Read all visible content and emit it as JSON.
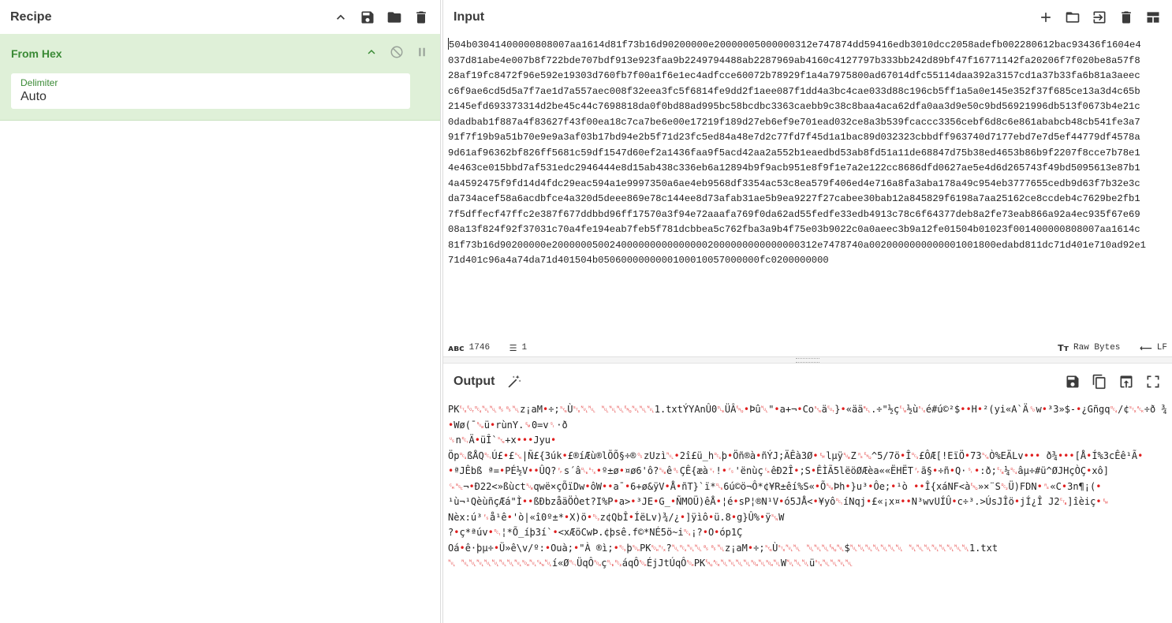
{
  "recipe": {
    "title": "Recipe",
    "operation": {
      "name": "From Hex",
      "delimiter_label": "Delimiter",
      "delimiter_value": "Auto"
    }
  },
  "input": {
    "title": "Input",
    "lines": [
      "504b03041400000808007aa1614d81f73b16d90200000e20000005000000312e747874dd59416edb3010dcc2058adefb002280612bac93436f1604e4",
      "037d81abe4e007b8f722bde707bdf913e923faa9b2249794488ab2287969ab4160c4127797b333bb242d89bf47f16771142fa20206f7f020be8a57f8",
      "28af19fc8472f96e592e19303d760fb7f00a1f6e1ec4adfcce60072b78929f1a4a7975800ad67014dfc55114daa392a3157cd1a37b33fa6b81a3aeec",
      "c6f9ae6cd5d5a7f7ae1d7a557aec008f32eea3fc5f6814fe9dd2f1aee087f1dd4a3bc4cae033d88c196cb5ff1a5a0e145e352f37f685ce13a3d4c65b",
      "2145efd693373314d2be45c44c7698818da0f0bd88ad995bc58bcdbc3363caebb9c38c8baa4aca62dfa0aa3d9e50c9bd56921996db513f0673b4e21c",
      "0dadbab1f887a4f83627f43f00ea18c7ca7be6e00e17219f189d27eb6ef9e701ead032ce8a3b539fcaccc3356cebf6d8c6e861ababcb48cb541fe3a7",
      "91f7f19b9a51b70e9e9a3af03b17bd94e2b5f71d23fc5ed84a48e7d2c77fd7f45d1a1bac89d032323cbbdff963740d7177ebd7e7d5ef44779df4578a",
      "9d61af96362bf826ff5681c59df1547d60ef2a1436faa9f5acd42aa2a552b1eaedbd53ab8fd51a11de68847d75b38ed4653b86b9f2207f8cce7b78e1",
      "4e463ce015bbd7af531edc2946444e8d15ab438c336eb6a12894b9f9acb951e8f9f1e7a2e122cc8686dfd0627ae5e4d6d265743f49bd5095613e87b1",
      "4a4592475f9fd14d4fdc29eac594a1e9997350a6ae4eb9568df3354ac53c8ea579f406ed4e716a8fa3aba178a49c954eb3777655cedb9d63f7b32e3c",
      "da734acef58a6acdbfce4a320d5deee869e78c144ee8d73afab31ae5b9ea9227f27cabee30bab12a845829f6198a7aa25162ce8ccdeb4c7629be2fb1",
      "7f5dffecf47ffc2e387f677ddbbd96ff17570a3f94e72aaafa769f0da62ad55fedfe33edb4913c78c6f64377deb8a2fe73eab866a92a4ec935f67e69",
      "08a13f824f92f37031c70a4fe194eab7feb5f781dcbbea5c762fba3a9b4f75e03b9022c0a0aeec3b9a12fe01504b01023f001400000808007aa1614c",
      "81f73b16d90200000e2000000500240000000000000002000000000000000312e7478740a0020000000000001001800edabd811dc71d401e710ad92e1",
      "71d401c96a4a74da71d401504b0506000000000100010057000000fc0200000000"
    ],
    "status_length": "1746",
    "status_lines": "1",
    "status_font": "Raw Bytes",
    "status_eol": "LF"
  },
  "output": {
    "title": "Output",
    "lines": [
      "PK␃␄␔␀␀␈␈␀z¡aM•÷;␖Ù␂␀␀ ␀␀␀␅␀␀␀1.txtÝYAnÛ0␐ÜÂ␅•Þû␀\"•a+¬•Co␖ä␄}•«ää␇.÷\"½ç␗½ù␂é#ú©²$••H•²(yi«A`Ä␎w•³3»$-•¿Gñgq␔/¢␂␆÷ð ¾",
      "•Wø(¯␚ü•rùnY.␙0=v␏·ð",
      "␟n␑Ä•üÎ`␖+x•••Jyu•",
      "Öp␔ßÅQ␑Ú£•£␖|Ñ£{3úk•£®íÆù®lÕÕ§÷®␝zUzì␀•2î£ü_h␔þ•Öñ®à•ñÝJ;ÄÊà3Ø•␙lµÿ␚Z␞␅^5/7ö•Î␓£ÔÆ[!EïÖ•73␖Ò%EÄLv••• ð¾•••[Å•Í%3cÊê¹Ã•",
      "•ªJÊbß ª=•PÉ½V••ÛQ?␌s´â␐␂•º±ø•¤ø6'ô?␚ê␈ÇÊ{æà␋!•␜'ënùç␍êÐ2Î•;S•ÊÌÃ5lëöØÆèa««ËHËT␌ã§•÷ñ•Q·␏•:ð;␗¼␔âµ÷#ü^ØJHçÒÇ•xô]",
      "␍␛¬•Ð22<»ßùct␚qwë×çÕïDw•ôW••a¯•6+ø&ÿV•Å•ñT}`ï*␐6ú©ö¬Ô*¢¥R±êí%S«•Õ␚Þh•}u³•Ôe;•¹ò ••Î{xáNF<à␅»×¨S␒Ü)FDN•␞«C•3n¶¡(•",
      "¹ù¬¹QèùñçÆá\"Ì••ßÐbzåäÖÒet?I%P•a>•³JE•G_•ÑMOÜ)êÅ•¦é•sP¦®N¹V•ó5JÅ<•¥yô␑íNqj•£«¡x¤••N³wvUÍÛ•c÷³.>ÚsJÎö•jÍ¿Î J2␗]îèiç•␙",
      "Nèx:ú³␜å¹ê•'ò|«î0º±*•X)ö•␒z¢QbÎ•ÍëLv)¾/¿•]ÿìô•ü.8•g}Û%•ÿ␖W",
      "?•ç*ªúv•␑¦*Õ_íþ3í`•<xÆöCwÞ.¢þsê.f©*NÉ5ö~i␔¡?•O•óp1Ç",
      "Oá•ê·þµ÷•Ü»ê\\v/º:•Ouà;•\"À ®ì;•␓þ␁PK␁␂?␀␔␀␀␈␈␀z¡aM•÷;␖Ù␂␀␀ ␀␀␀␅␀$␀␀␀␀␀␀␀ ␀␀␀␀␀␀␀␀1.txt",
      "␀ ␀␀␀␀␀␀␀␀␁␀␘␀í«Ø␑ÜqÔ␁ç␐­␒áqÔ␁ÉjJtÚqÔ␁PK␅␆␀␀␀␀␁␀␁␀W␀␀␀ü␂␀␀␀␀"
    ]
  },
  "colors": {
    "op_bg": "#dff0d8",
    "op_title": "#3a8a35",
    "control_char": "#e01e1e"
  }
}
